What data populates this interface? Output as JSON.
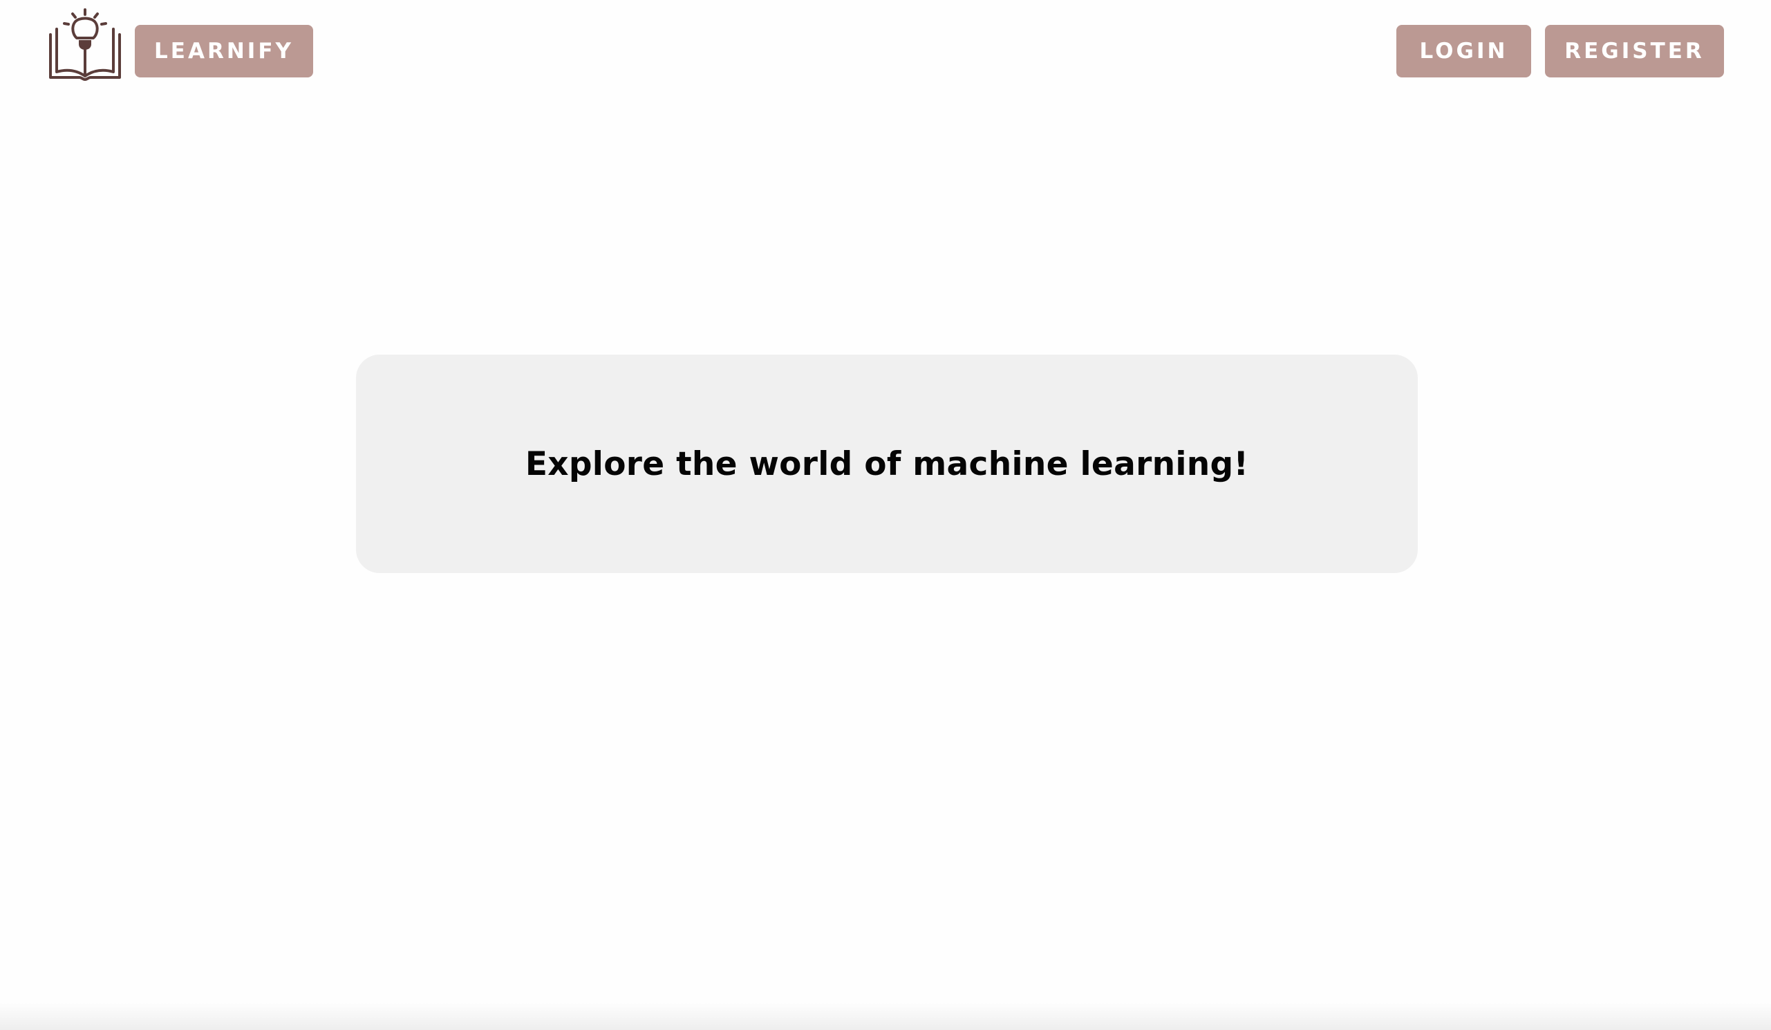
{
  "header": {
    "logo_icon": "book-lightbulb-icon",
    "brand_label": "LEARNIFY",
    "login_label": "LOGIN",
    "register_label": "REGISTER"
  },
  "hero": {
    "text": "Explore the world of machine learning!"
  },
  "colors": {
    "button_bg": "#bb9993",
    "button_text": "#ffffff",
    "logo": "#5b3d3a",
    "card_bg": "#f0f0f0",
    "page_bg": "#fefefe"
  }
}
